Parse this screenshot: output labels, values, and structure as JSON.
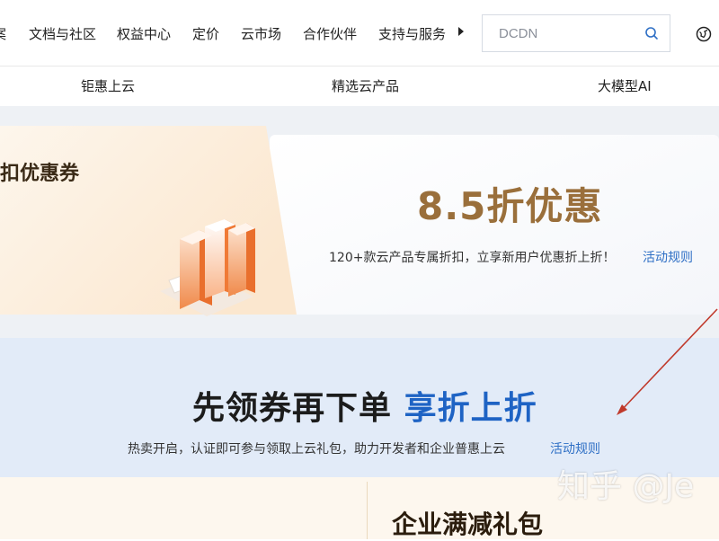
{
  "nav": {
    "items": [
      "案",
      "文档与社区",
      "权益中心",
      "定价",
      "云市场",
      "合作伙伴",
      "支持与服务"
    ],
    "search_placeholder": "DCDN"
  },
  "subnav": {
    "items": [
      "钜惠上云",
      "精选云产品",
      "大模型AI"
    ]
  },
  "coupon": {
    "left_title": "扣优惠券",
    "discount_title": "8.5折优惠",
    "description": "120+款云产品专属折扣，立享新用户优惠折上折！",
    "rule_link": "活动规则"
  },
  "banner": {
    "headline_dark": "先领券再下单",
    "headline_blue": "享折上折",
    "subtext": "热卖开启，认证即可参与领取上云礼包，助力开发者和企业普惠上云",
    "rule_link": "活动规则"
  },
  "bottom": {
    "title": "企业满减礼包"
  },
  "watermark": "知乎 @Je",
  "colors": {
    "accent_blue": "#1e63c4",
    "gold": "#9a6f3b",
    "annotation_red": "#c0392b"
  }
}
